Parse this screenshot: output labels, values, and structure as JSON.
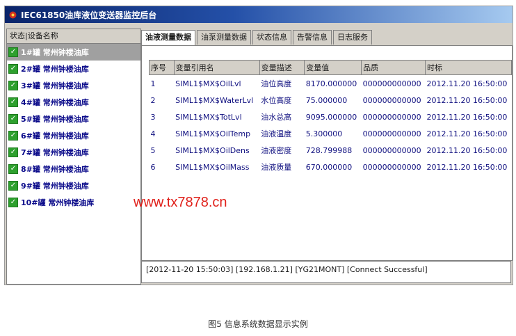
{
  "window": {
    "title": "IEC61850油库液位变送器监控后台"
  },
  "device_list": {
    "header": "状态|设备名称",
    "items": [
      "1#罐 常州钟楼油库",
      "2#罐 常州钟楼油库",
      "3#罐 常州钟楼油库",
      "4#罐 常州钟楼油库",
      "5#罐 常州钟楼油库",
      "6#罐 常州钟楼油库",
      "7#罐 常州钟楼油库",
      "8#罐 常州钟楼油库",
      "9#罐 常州钟楼油库",
      "10#罐 常州钟楼油库"
    ],
    "selected": 0
  },
  "tabs": [
    "油液测量数据",
    "油泵测量数据",
    "状态信息",
    "告警信息",
    "日志服务"
  ],
  "table": {
    "headers": [
      "序号",
      "变量引用名",
      "变量描述",
      "变量值",
      "品质",
      "时标"
    ],
    "rows": [
      [
        "1",
        "SIML1$MX$OilLvl",
        "油位高度",
        "8170.000000",
        "000000000000",
        "2012.11.20 16:50:00"
      ],
      [
        "2",
        "SIML1$MX$WaterLvl",
        "水位高度",
        "75.000000",
        "000000000000",
        "2012.11.20 16:50:00"
      ],
      [
        "3",
        "SIML1$MX$TotLvl",
        "油水总高",
        "9095.000000",
        "000000000000",
        "2012.11.20 16:50:00"
      ],
      [
        "4",
        "SIML1$MX$OilTemp",
        "油液温度",
        "5.300000",
        "000000000000",
        "2012.11.20 16:50:00"
      ],
      [
        "5",
        "SIML1$MX$OilDens",
        "油液密度",
        "728.799988",
        "000000000000",
        "2012.11.20 16:50:00"
      ],
      [
        "6",
        "SIML1$MX$OilMass",
        "油液质量",
        "670.000000",
        "000000000000",
        "2012.11.20 16:50:00"
      ]
    ]
  },
  "log": {
    "text": "[2012-11-20  15:50:03]  [192.168.1.21]  [YG21MONT]  [Connect Successful]"
  },
  "watermark": "www.tx7878.cn",
  "caption": "图5   信息系统数据显示实例"
}
